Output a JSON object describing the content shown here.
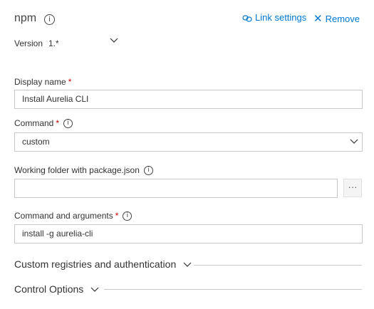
{
  "task": {
    "title": "npm",
    "link_settings_label": "Link settings",
    "remove_label": "Remove"
  },
  "version": {
    "label": "Version",
    "value": "1.*"
  },
  "fields": {
    "display_name": {
      "label": "Display name",
      "required_mark": "*",
      "value": "Install Aurelia CLI"
    },
    "command": {
      "label": "Command",
      "required_mark": "*",
      "value": "custom"
    },
    "working_folder": {
      "label": "Working folder with package.json",
      "value": "",
      "browse_label": "···"
    },
    "command_args": {
      "label": "Command and arguments",
      "required_mark": "*",
      "value": "install -g aurelia-cli"
    }
  },
  "sections": {
    "custom_registries": "Custom registries and authentication",
    "control_options": "Control Options"
  },
  "colors": {
    "link": "#0078d4",
    "required": "#cc0000",
    "border": "#c8c8c8"
  },
  "icons": [
    "info-icon",
    "link-icon",
    "close-icon",
    "chevron-down-icon"
  ]
}
